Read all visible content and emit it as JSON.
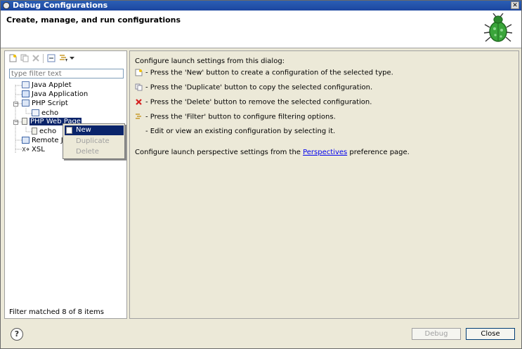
{
  "window": {
    "title": "Debug Configurations"
  },
  "header": {
    "title": "Create, manage, and run configurations",
    "icon": "bug-icon"
  },
  "left": {
    "filter_placeholder": "type filter text",
    "tree": [
      {
        "label": "Java Applet",
        "icon": "java-applet-icon"
      },
      {
        "label": "Java Application",
        "icon": "java-application-icon"
      },
      {
        "label": "PHP Script",
        "icon": "php-script-icon",
        "expanded": true
      },
      {
        "label": "echo",
        "icon": "php-config-icon"
      },
      {
        "label": "PHP Web Page",
        "icon": "php-web-page-icon",
        "expanded": true,
        "selected": true
      },
      {
        "label": "echo",
        "icon": "php-web-config-icon"
      },
      {
        "label": "Remote J",
        "icon": "remote-java-icon"
      },
      {
        "label": "XSL",
        "icon": "xsl-icon"
      }
    ],
    "status": "Filter matched 8 of 8 items"
  },
  "context_menu": {
    "items": [
      {
        "label": "New",
        "state": "active"
      },
      {
        "label": "Duplicate",
        "state": "disabled"
      },
      {
        "label": "Delete",
        "state": "disabled"
      }
    ]
  },
  "right": {
    "intro": "Configure launch settings from this dialog:",
    "lines": [
      "- Press the 'New' button to create a configuration of the selected type.",
      "- Press the 'Duplicate' button to copy the selected configuration.",
      "- Press the 'Delete' button to remove the selected configuration.",
      "- Press the 'Filter' button to configure filtering options.",
      "- Edit or view an existing configuration by selecting it."
    ],
    "perspective_prefix": "Configure launch perspective settings from the ",
    "perspective_link": "Perspectives",
    "perspective_suffix": " preference page."
  },
  "buttons": {
    "debug": "Debug",
    "close": "Close",
    "help": "?"
  },
  "colors": {
    "selection": "#0a246a",
    "title_bar": "#1c46a0",
    "link": "#0000ee"
  }
}
